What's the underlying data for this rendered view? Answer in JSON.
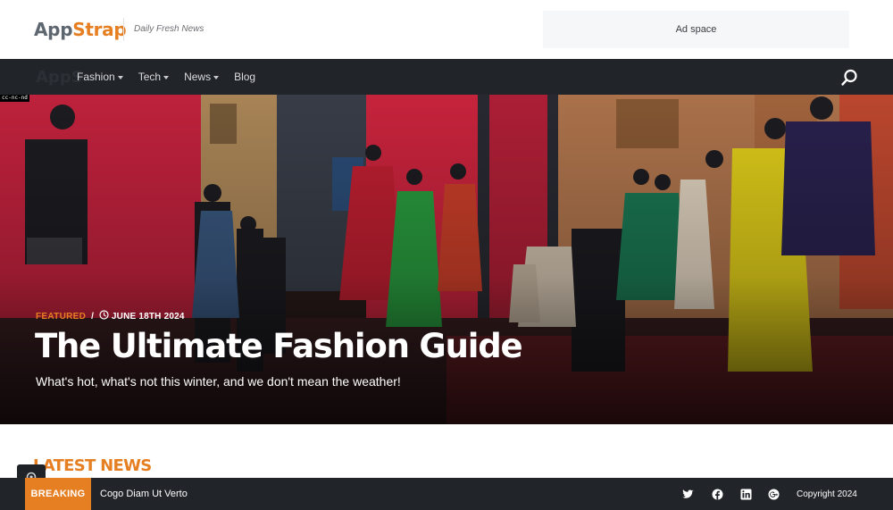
{
  "brand": {
    "name_part1": "App",
    "name_part2": "Strap",
    "tagline": "Daily Fresh News"
  },
  "ad": {
    "label": "Ad space"
  },
  "nav": {
    "ghost_logo": "AppS",
    "items": [
      {
        "label": "Fashion",
        "has_dropdown": true
      },
      {
        "label": "Tech",
        "has_dropdown": true
      },
      {
        "label": "News",
        "has_dropdown": true
      },
      {
        "label": "Blog",
        "has_dropdown": false
      }
    ],
    "search_icon": "search-icon"
  },
  "hero": {
    "image_label": "cc-nc-nd",
    "category": "FEATURED",
    "separator": "/",
    "date_icon": "clock-icon",
    "date": "JUNE 18TH 2024",
    "title": "The Ultimate Fashion Guide",
    "subtitle": "What's hot, what's not this winter, and we don't mean the weather!"
  },
  "latest": {
    "title": "LATEST NEWS"
  },
  "breaking": {
    "label": "BREAKING",
    "headline": "Cogo Diam Ut Verto"
  },
  "social_icons": [
    "twitter-icon",
    "facebook-icon",
    "linkedin-icon",
    "google-plus-icon"
  ],
  "footer": {
    "copyright": "Copyright 2024"
  },
  "colors": {
    "accent": "#e67e22",
    "dark": "#212429",
    "ad_bg": "#f6f7f8"
  }
}
